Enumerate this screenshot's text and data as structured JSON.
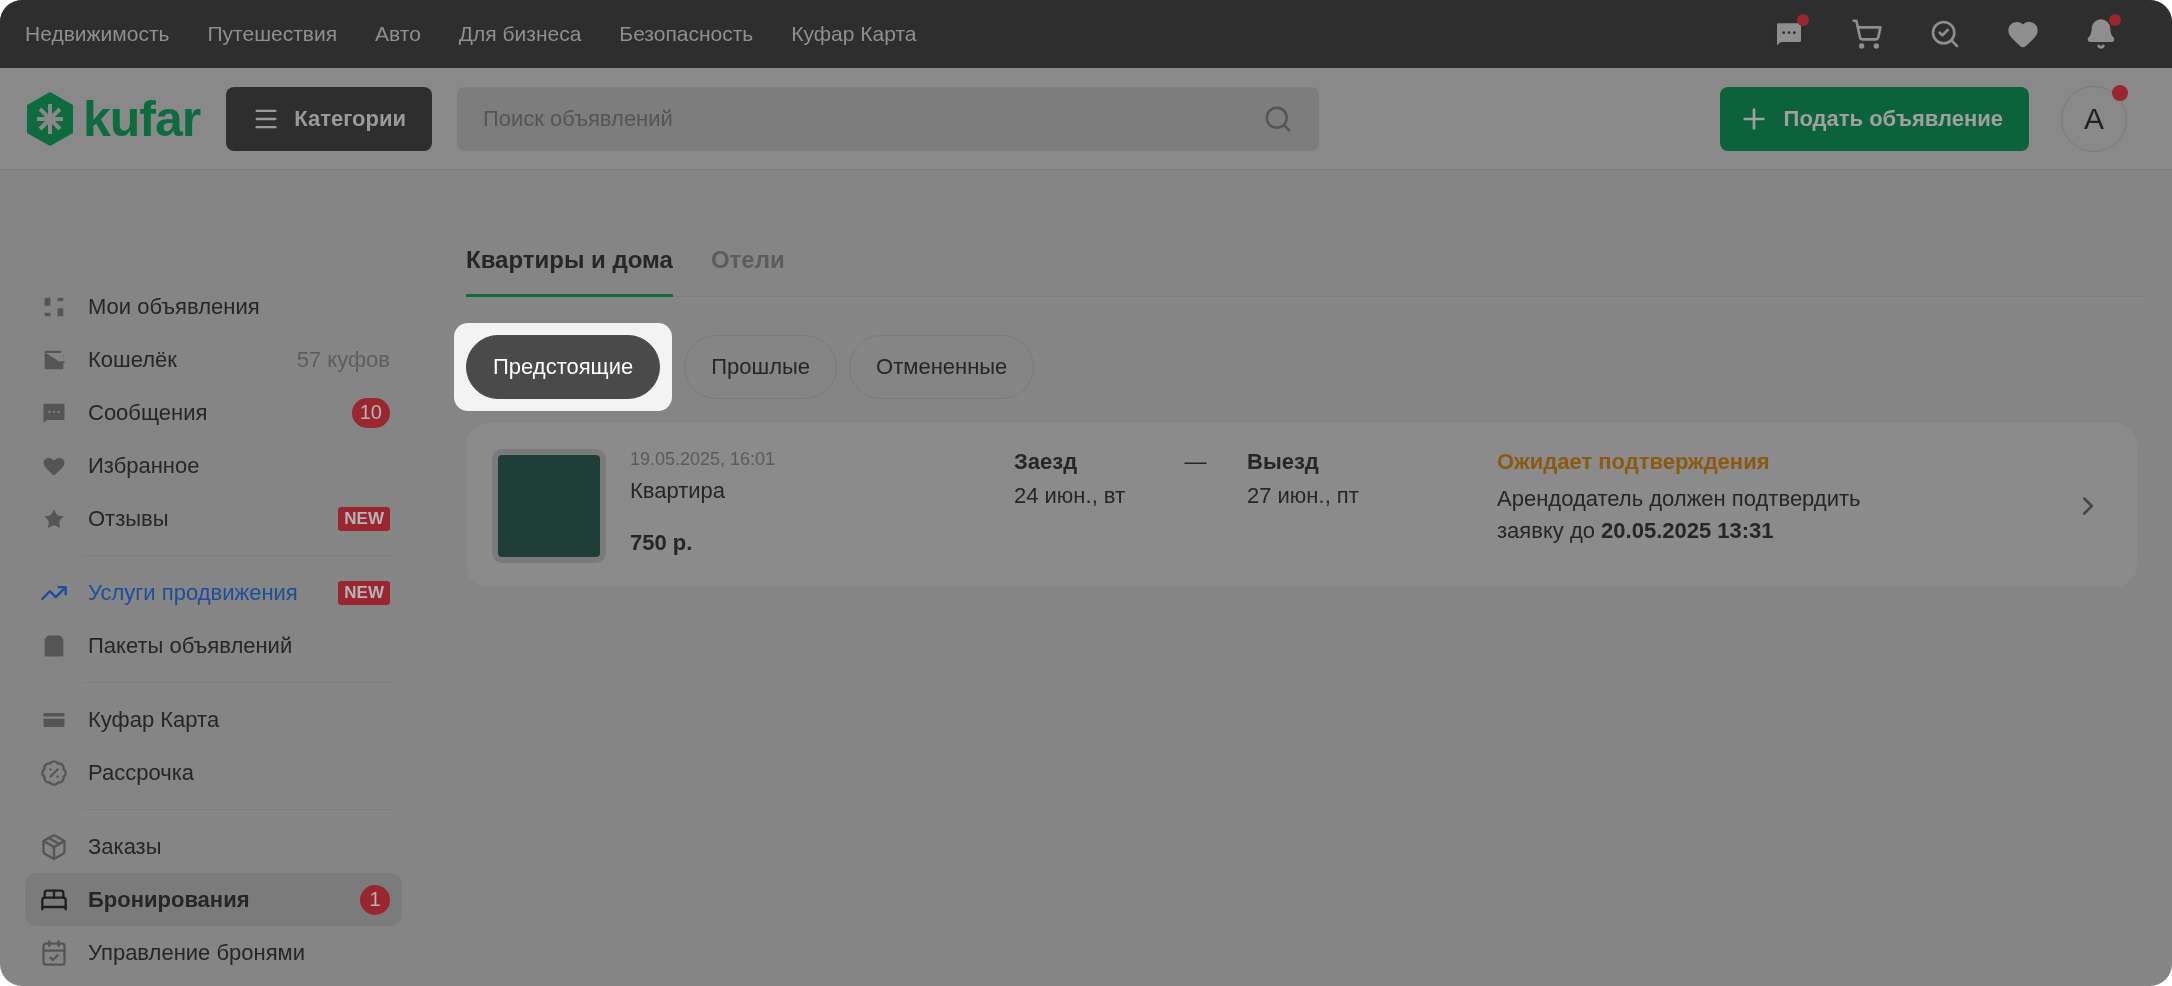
{
  "top_nav": {
    "links": [
      "Недвижимость",
      "Путешествия",
      "Авто",
      "Для бизнеса",
      "Безопасность",
      "Куфар Карта"
    ],
    "icons": [
      {
        "dot": true
      },
      {
        "dot": false
      },
      {
        "dot": false
      },
      {
        "dot": false
      },
      {
        "dot": true
      }
    ]
  },
  "header": {
    "logo": "kufar",
    "categories_button": "Категории",
    "search": {
      "placeholder": "Поиск объявлений"
    },
    "post_button": "Подать объявление",
    "avatar": {
      "letter": "A",
      "dot": true
    }
  },
  "sidebar": {
    "groups": [
      {
        "items": [
          {
            "label": "Мои объявления",
            "selected": false,
            "accent": false
          },
          {
            "label": "Кошелёк",
            "trailing": {
              "kind": "text",
              "text": "57 куфов"
            },
            "selected": false,
            "accent": false
          },
          {
            "label": "Сообщения",
            "trailing": {
              "kind": "count",
              "text": "10"
            },
            "selected": false,
            "accent": false
          },
          {
            "label": "Избранное",
            "selected": false,
            "accent": false
          },
          {
            "label": "Отзывы",
            "trailing": {
              "kind": "new",
              "text": "NEW"
            },
            "selected": false,
            "accent": false
          }
        ]
      },
      {
        "items": [
          {
            "label": "Услуги продвижения",
            "trailing": {
              "kind": "new",
              "text": "NEW"
            },
            "selected": false,
            "accent": true
          },
          {
            "label": "Пакеты объявлений",
            "selected": false,
            "accent": false
          }
        ]
      },
      {
        "items": [
          {
            "label": "Куфар Карта",
            "selected": false,
            "accent": false
          },
          {
            "label": "Рассрочка",
            "selected": false,
            "accent": false
          }
        ]
      },
      {
        "items": [
          {
            "label": "Заказы",
            "selected": false,
            "accent": false
          },
          {
            "label": "Бронирования",
            "trailing": {
              "kind": "count",
              "text": "1"
            },
            "selected": true,
            "accent": false
          },
          {
            "label": "Управление бронями",
            "selected": false,
            "accent": false
          }
        ]
      }
    ]
  },
  "tabs": [
    {
      "label": "Квартиры и дома",
      "selected": true
    },
    {
      "label": "Отели",
      "selected": false
    }
  ],
  "filters": [
    {
      "label": "Предстоящие",
      "selected": true
    },
    {
      "label": "Прошлые",
      "selected": false
    },
    {
      "label": "Отмененные",
      "selected": false
    }
  ],
  "bookings": [
    {
      "created": "19.05.2025, 16:01",
      "type": "Квартира",
      "price": "750 р.",
      "checkin_label": "Заезд",
      "checkin_date": "24 июн., вт",
      "dash": "—",
      "checkout_label": "Выезд",
      "checkout_date": "27 июн., пт",
      "status": "Ожидает подтверждения",
      "note": "Арендодатель должен подтвердить заявку до **20.05.2025 13:31**"
    }
  ]
}
